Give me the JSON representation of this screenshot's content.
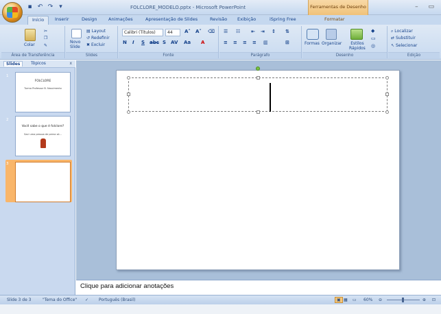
{
  "window": {
    "title": "FOLCLORE_MODELO.pptx - Microsoft PowerPoint",
    "context_header": "Ferramentas de Desenho"
  },
  "tabs": [
    "Início",
    "Inserir",
    "Design",
    "Animações",
    "Apresentação de Slides",
    "Revisão",
    "Exibição",
    "iSpring Free",
    "Formatar"
  ],
  "ribbon": {
    "clipboard": {
      "label": "Área de Transferência",
      "paste": "Colar"
    },
    "slides": {
      "label": "Slides",
      "new_slide": "Novo\nSlide",
      "layout": "Layout",
      "reset": "Redefinir",
      "delete": "Excluir"
    },
    "font": {
      "label": "Fonte",
      "font_name": "Calibri (Títulos)",
      "font_size": "44"
    },
    "paragraph": {
      "label": "Parágrafo"
    },
    "drawing": {
      "label": "Desenho",
      "shapes": "Formas",
      "arrange": "Organizar",
      "quick_styles": "Estilos\nRápidos"
    },
    "editing": {
      "label": "Edição",
      "find": "Localizar",
      "replace": "Substituir",
      "select": "Selecionar"
    }
  },
  "pane": {
    "tab_slides": "Slides",
    "tab_outline": "Tópicos",
    "close": "x",
    "thumbs": [
      {
        "num": "1",
        "title": "FOLCLORE",
        "sub": "Turma Professor B. Nascimento"
      },
      {
        "num": "2",
        "title": "Você sabe o que é folclore?",
        "sub": "Saci uma pessoa de perna só..."
      },
      {
        "num": "3",
        "title": "",
        "sub": ""
      }
    ]
  },
  "notes": {
    "placeholder": "Clique para adicionar anotações"
  },
  "status": {
    "slide": "Slide 3 de 3",
    "theme": "\"Tema do Office\"",
    "language": "Português (Brasil)",
    "zoom": "60%"
  }
}
